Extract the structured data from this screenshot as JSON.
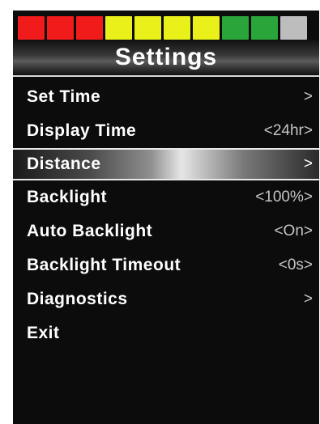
{
  "status_bar": {
    "segments": [
      {
        "color": "#f21b1b",
        "state": "filled"
      },
      {
        "color": "#f21b1b",
        "state": "filled"
      },
      {
        "color": "#f21b1b",
        "state": "filled"
      },
      {
        "color": "#eaf01a",
        "state": "filled"
      },
      {
        "color": "#eaf01a",
        "state": "filled"
      },
      {
        "color": "#eaf01a",
        "state": "filled"
      },
      {
        "color": "#eaf01a",
        "state": "filled"
      },
      {
        "color": "#2aa53a",
        "state": "filled"
      },
      {
        "color": "#2aa53a",
        "state": "filled"
      },
      {
        "color": "#bdbdbd",
        "state": "empty"
      }
    ],
    "level": "9/10"
  },
  "header": {
    "title": "Settings"
  },
  "menu": {
    "items": [
      {
        "label": "Set Time",
        "value": ">",
        "selected": false
      },
      {
        "label": "Display Time",
        "value": "<24hr>",
        "selected": false
      },
      {
        "label": "Distance",
        "value": ">",
        "selected": true
      },
      {
        "label": "Backlight",
        "value": "<100%>",
        "selected": false
      },
      {
        "label": "Auto Backlight",
        "value": "<On>",
        "selected": false
      },
      {
        "label": "Backlight Timeout",
        "value": "<0s>",
        "selected": false
      },
      {
        "label": "Diagnostics",
        "value": ">",
        "selected": false
      },
      {
        "label": "Exit",
        "value": "",
        "selected": false
      }
    ]
  }
}
